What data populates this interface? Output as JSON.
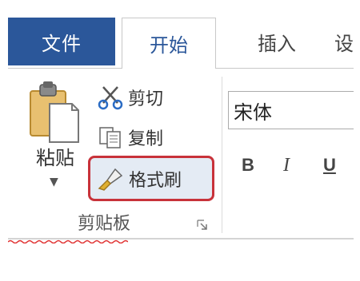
{
  "tabs": {
    "file": "文件",
    "home": "开始",
    "insert": "插入",
    "partial": "设"
  },
  "clipboard": {
    "paste_label": "粘贴",
    "cut_label": "剪切",
    "copy_label": "复制",
    "format_painter_label": "格式刷",
    "group_label": "剪贴板"
  },
  "font": {
    "font_name": "宋体",
    "bold_label": "B",
    "italic_label": "I",
    "underline_label": "U"
  },
  "colors": {
    "file_tab_bg": "#2b579a",
    "highlight_border": "#c8323a",
    "highlight_bg": "#e4ebf4"
  },
  "icons": [
    "clipboard-icon",
    "scissors-icon",
    "copy-icon",
    "paintbrush-icon",
    "dialog-launcher-icon",
    "dropdown-arrow-icon"
  ]
}
